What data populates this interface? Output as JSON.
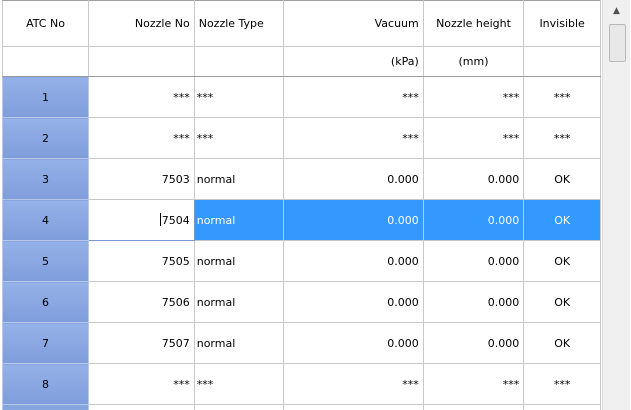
{
  "columns": {
    "atc_no": "ATC No",
    "nozzle_no": "Nozzle No",
    "nozzle_type": "Nozzle Type",
    "vacuum": "Vacuum",
    "nozzle_height": "Nozzle height",
    "invisible": "Invisible"
  },
  "units": {
    "vacuum": "(kPa)",
    "nozzle_height": "(mm)"
  },
  "rows": [
    {
      "atc": "1",
      "nozzle_no": "***",
      "type": "***",
      "vacuum": "***",
      "height": "***",
      "invisible": "***"
    },
    {
      "atc": "2",
      "nozzle_no": "***",
      "type": "***",
      "vacuum": "***",
      "height": "***",
      "invisible": "***"
    },
    {
      "atc": "3",
      "nozzle_no": "7503",
      "type": "normal",
      "vacuum": "0.000",
      "height": "0.000",
      "invisible": "OK"
    },
    {
      "atc": "4",
      "nozzle_no": "7504",
      "type": "normal",
      "vacuum": "0.000",
      "height": "0.000",
      "invisible": "OK"
    },
    {
      "atc": "5",
      "nozzle_no": "7505",
      "type": "normal",
      "vacuum": "0.000",
      "height": "0.000",
      "invisible": "OK"
    },
    {
      "atc": "6",
      "nozzle_no": "7506",
      "type": "normal",
      "vacuum": "0.000",
      "height": "0.000",
      "invisible": "OK"
    },
    {
      "atc": "7",
      "nozzle_no": "7507",
      "type": "normal",
      "vacuum": "0.000",
      "height": "0.000",
      "invisible": "OK"
    },
    {
      "atc": "8",
      "nozzle_no": "***",
      "type": "***",
      "vacuum": "***",
      "height": "***",
      "invisible": "***"
    }
  ],
  "selected_row_index": 3,
  "colors": {
    "selection": "#3399ff",
    "row_header": "#86a6e0"
  },
  "scrollbar": {
    "up_arrow_icon": "triangle-up-icon"
  }
}
